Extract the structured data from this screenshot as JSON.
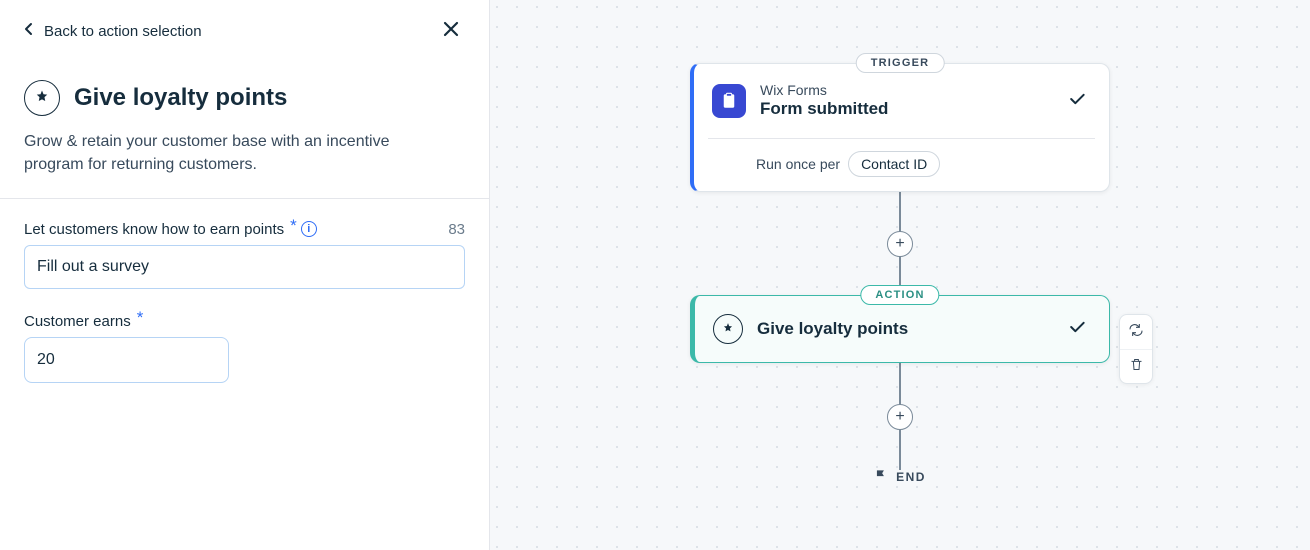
{
  "panel": {
    "back_label": "Back to action selection",
    "title": "Give loyalty points",
    "description": "Grow & retain your customer base with an incentive program for returning customers.",
    "fields": {
      "points_msg": {
        "label": "Let customers know how to earn points",
        "value": "Fill out a survey",
        "char_remaining": "83"
      },
      "earns": {
        "label": "Customer earns",
        "value": "20"
      }
    }
  },
  "flow": {
    "trigger": {
      "badge": "TRIGGER",
      "app": "Wix Forms",
      "event": "Form submitted",
      "run_once_label": "Run once per",
      "run_once_chip": "Contact ID"
    },
    "action": {
      "badge": "ACTION",
      "title": "Give loyalty points"
    },
    "end_label": "END"
  },
  "icons": {
    "loyalty": "star-burst-icon",
    "forms": "clipboard-icon",
    "check": "check-icon",
    "repeat": "repeat-icon",
    "trash": "trash-icon",
    "plus": "plus-icon",
    "flag": "flag-icon"
  }
}
